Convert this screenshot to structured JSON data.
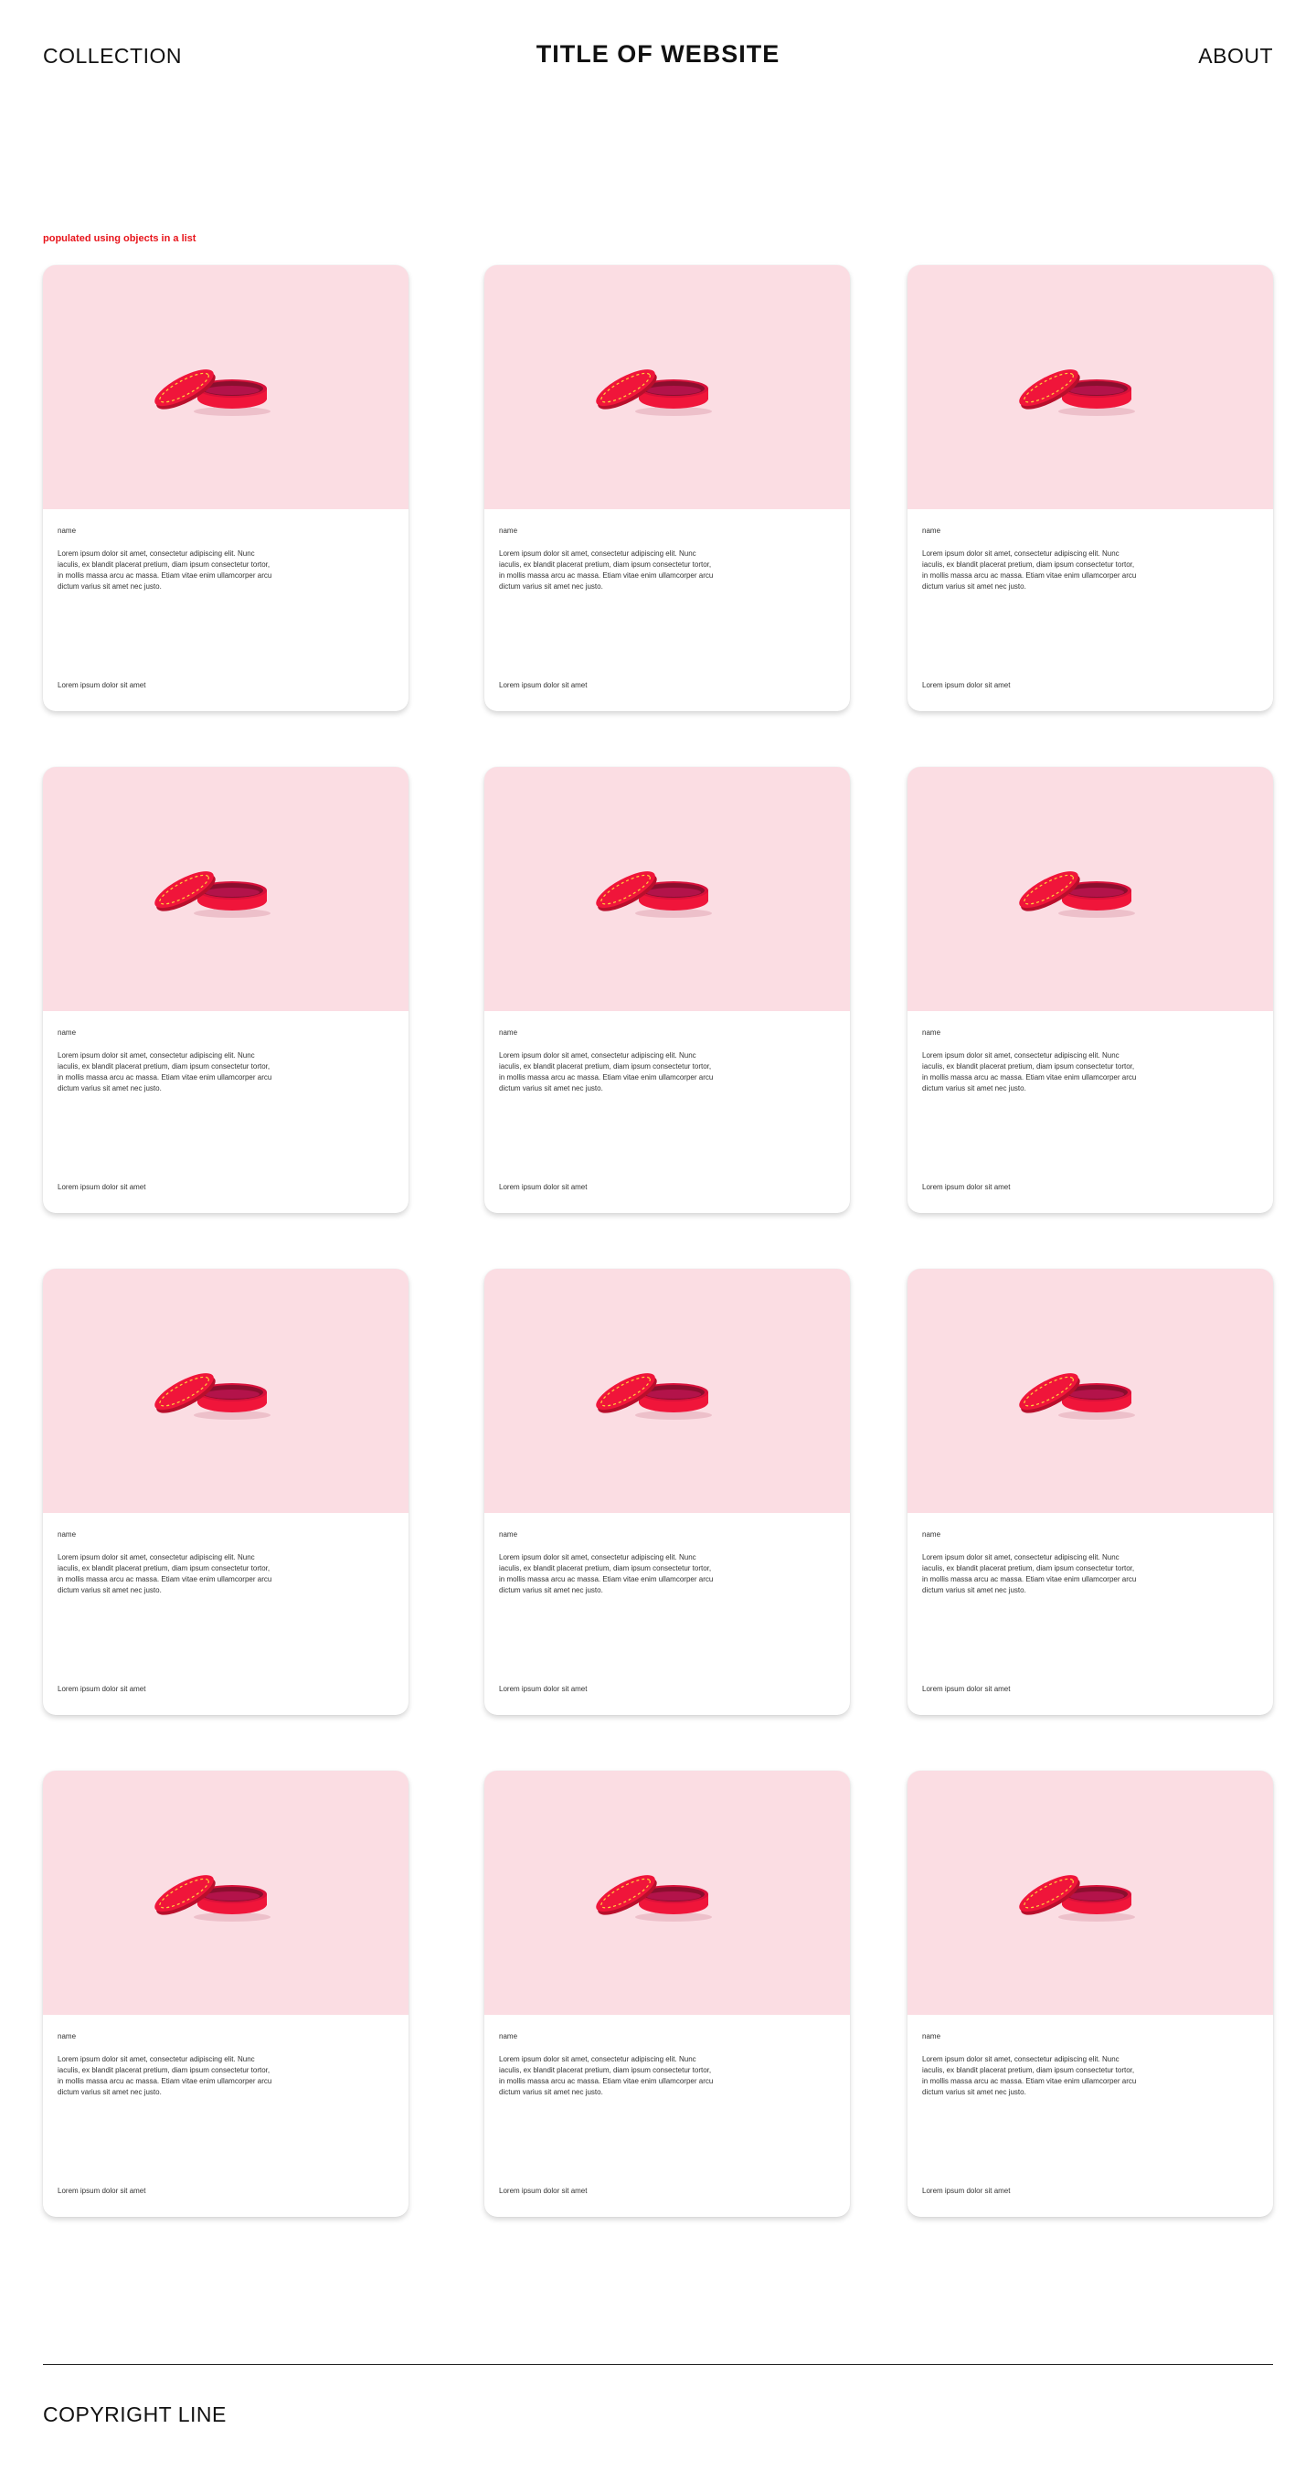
{
  "header": {
    "left_link": "COLLECTION",
    "title": "TITLE OF WEBSITE",
    "right_link": "ABOUT"
  },
  "section_label": "populated using objects in a list",
  "cards": [
    {
      "name": "name",
      "description": "Lorem ipsum dolor sit amet, consectetur adipiscing elit. Nunc iaculis, ex blandit placerat pretium, diam ipsum consectetur tortor, in mollis massa arcu ac massa. Etiam vitae enim ullamcorper arcu dictum varius sit amet nec justo.",
      "footer": "Lorem ipsum dolor sit amet"
    },
    {
      "name": "name",
      "description": "Lorem ipsum dolor sit amet, consectetur adipiscing elit. Nunc iaculis, ex blandit placerat pretium, diam ipsum consectetur tortor, in mollis massa arcu ac massa. Etiam vitae enim ullamcorper arcu dictum varius sit amet nec justo.",
      "footer": "Lorem ipsum dolor sit amet"
    },
    {
      "name": "name",
      "description": "Lorem ipsum dolor sit amet, consectetur adipiscing elit. Nunc iaculis, ex blandit placerat pretium, diam ipsum consectetur tortor, in mollis massa arcu ac massa. Etiam vitae enim ullamcorper arcu dictum varius sit amet nec justo.",
      "footer": "Lorem ipsum dolor sit amet"
    },
    {
      "name": "name",
      "description": "Lorem ipsum dolor sit amet, consectetur adipiscing elit. Nunc iaculis, ex blandit placerat pretium, diam ipsum consectetur tortor, in mollis massa arcu ac massa. Etiam vitae enim ullamcorper arcu dictum varius sit amet nec justo.",
      "footer": "Lorem ipsum dolor sit amet"
    },
    {
      "name": "name",
      "description": "Lorem ipsum dolor sit amet, consectetur adipiscing elit. Nunc iaculis, ex blandit placerat pretium, diam ipsum consectetur tortor, in mollis massa arcu ac massa. Etiam vitae enim ullamcorper arcu dictum varius sit amet nec justo.",
      "footer": "Lorem ipsum dolor sit amet"
    },
    {
      "name": "name",
      "description": "Lorem ipsum dolor sit amet, consectetur adipiscing elit. Nunc iaculis, ex blandit placerat pretium, diam ipsum consectetur tortor, in mollis massa arcu ac massa. Etiam vitae enim ullamcorper arcu dictum varius sit amet nec justo.",
      "footer": "Lorem ipsum dolor sit amet"
    },
    {
      "name": "name",
      "description": "Lorem ipsum dolor sit amet, consectetur adipiscing elit. Nunc iaculis, ex blandit placerat pretium, diam ipsum consectetur tortor, in mollis massa arcu ac massa. Etiam vitae enim ullamcorper arcu dictum varius sit amet nec justo.",
      "footer": "Lorem ipsum dolor sit amet"
    },
    {
      "name": "name",
      "description": "Lorem ipsum dolor sit amet, consectetur adipiscing elit. Nunc iaculis, ex blandit placerat pretium, diam ipsum consectetur tortor, in mollis massa arcu ac massa. Etiam vitae enim ullamcorper arcu dictum varius sit amet nec justo.",
      "footer": "Lorem ipsum dolor sit amet"
    },
    {
      "name": "name",
      "description": "Lorem ipsum dolor sit amet, consectetur adipiscing elit. Nunc iaculis, ex blandit placerat pretium, diam ipsum consectetur tortor, in mollis massa arcu ac massa. Etiam vitae enim ullamcorper arcu dictum varius sit amet nec justo.",
      "footer": "Lorem ipsum dolor sit amet"
    },
    {
      "name": "name",
      "description": "Lorem ipsum dolor sit amet, consectetur adipiscing elit. Nunc iaculis, ex blandit placerat pretium, diam ipsum consectetur tortor, in mollis massa arcu ac massa. Etiam vitae enim ullamcorper arcu dictum varius sit amet nec justo.",
      "footer": "Lorem ipsum dolor sit amet"
    },
    {
      "name": "name",
      "description": "Lorem ipsum dolor sit amet, consectetur adipiscing elit. Nunc iaculis, ex blandit placerat pretium, diam ipsum consectetur tortor, in mollis massa arcu ac massa. Etiam vitae enim ullamcorper arcu dictum varius sit amet nec justo.",
      "footer": "Lorem ipsum dolor sit amet"
    },
    {
      "name": "name",
      "description": "Lorem ipsum dolor sit amet, consectetur adipiscing elit. Nunc iaculis, ex blandit placerat pretium, diam ipsum consectetur tortor, in mollis massa arcu ac massa. Etiam vitae enim ullamcorper arcu dictum varius sit amet nec justo.",
      "footer": "Lorem ipsum dolor sit amet"
    }
  ],
  "footer": {
    "copyright": "COPYRIGHT LINE"
  },
  "colors": {
    "accent": "#e8141b",
    "image_bg": "#fbdde3",
    "tin_red": "#f0153a",
    "tin_dark": "#8a0f2e"
  },
  "icons": {
    "product_image": "lip-balm-tin-icon"
  }
}
